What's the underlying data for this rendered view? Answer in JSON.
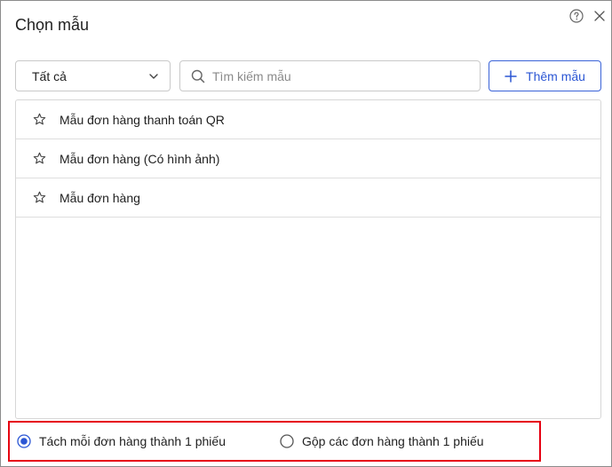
{
  "dialog": {
    "title": "Chọn mẫu",
    "help_icon": "help-circle-icon",
    "close_icon": "close-icon"
  },
  "filter": {
    "selected": "Tất cả",
    "icon": "chevron-down-icon"
  },
  "search": {
    "placeholder": "Tìm kiếm mẫu",
    "value": "",
    "icon": "search-icon"
  },
  "add_button": {
    "label": "Thêm mẫu",
    "icon": "plus-icon",
    "color": "#2b56d4"
  },
  "templates": [
    {
      "name": "Mẫu đơn hàng thanh toán QR",
      "icon": "star-outline-icon"
    },
    {
      "name": "Mẫu đơn hàng (Có hình ảnh)",
      "icon": "star-outline-icon"
    },
    {
      "name": "Mẫu đơn hàng",
      "icon": "star-outline-icon"
    }
  ],
  "print_mode": {
    "options": [
      {
        "label": "Tách mỗi đơn hàng thành 1 phiếu",
        "selected": true
      },
      {
        "label": "Gộp các đơn hàng thành 1 phiếu",
        "selected": false
      }
    ],
    "highlight_color": "#e60012"
  }
}
